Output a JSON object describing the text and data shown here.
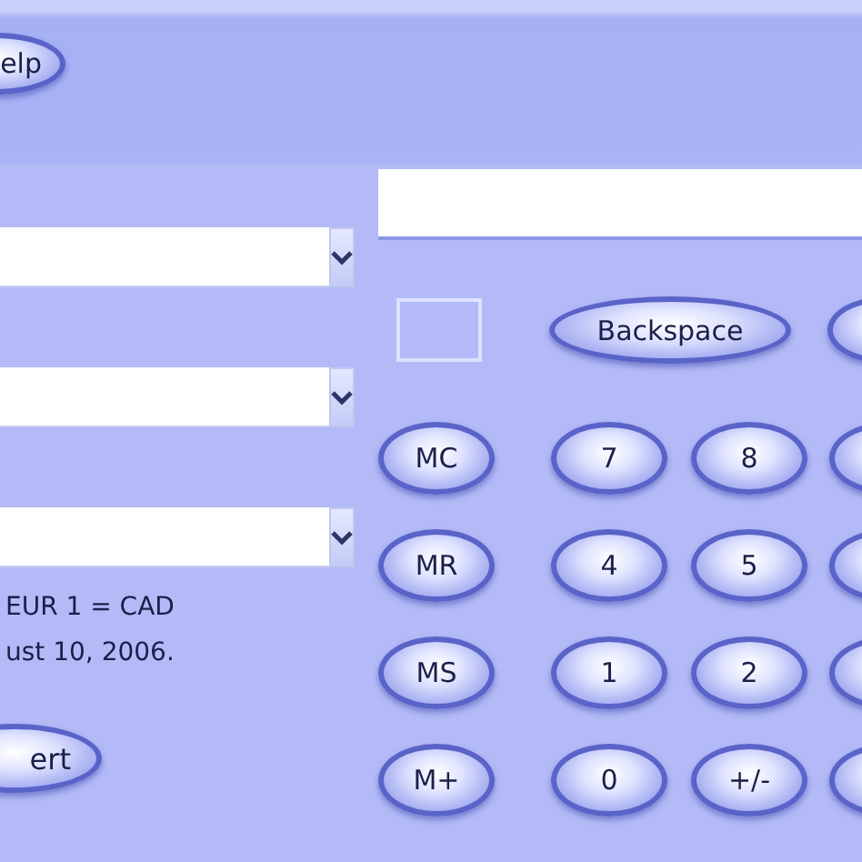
{
  "help_button": {
    "label": "elp"
  },
  "dropdowns": [
    {
      "expanded": false
    },
    {
      "expanded": false
    },
    {
      "expanded": false
    }
  ],
  "rate_lines": [
    "EUR 1 = CAD",
    "ust 10, 2006."
  ],
  "convert_button": {
    "label": "ert"
  },
  "backspace_button": {
    "label": "Backspace"
  },
  "key_rows": [
    [
      "MC",
      "7",
      "8"
    ],
    [
      "MR",
      "4",
      "5"
    ],
    [
      "MS",
      "1",
      "2"
    ],
    [
      "M+",
      "0",
      "+/-"
    ]
  ]
}
